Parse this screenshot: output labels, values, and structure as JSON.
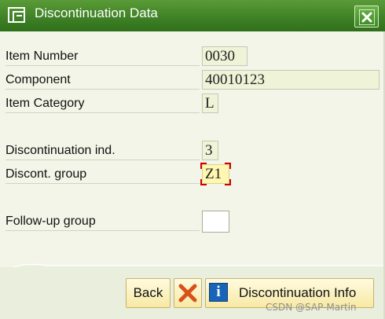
{
  "window": {
    "title": "Discontinuation Data",
    "title_icon": "window-dialog-icon",
    "close_icon": "close-icon"
  },
  "fields": {
    "item_number": {
      "label": "Item Number",
      "value": "0030"
    },
    "component": {
      "label": "Component",
      "value": "40010123"
    },
    "item_category": {
      "label": "Item Category",
      "value": "L"
    },
    "discontinuation_ind": {
      "label": "Discontinuation ind.",
      "value": "3"
    },
    "discont_group": {
      "label": "Discont. group",
      "value": "Z1"
    },
    "followup_group": {
      "label": "Follow-up group",
      "value": ""
    }
  },
  "buttons": {
    "back": "Back",
    "cancel_icon": "cancel-x-icon",
    "info_icon": "info-icon",
    "info_glyph": "i",
    "discontinuation_info": "Discontinuation Info"
  },
  "watermark": "CSDN @SAP-Martin",
  "colors": {
    "titlebar": "#3f8226",
    "background": "#f2f5e7",
    "button": "#f7e9a4",
    "focus_marker": "#d00000"
  }
}
